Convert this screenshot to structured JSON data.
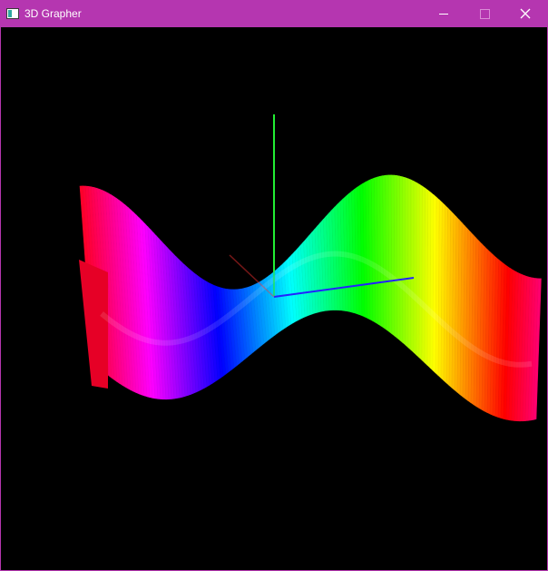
{
  "window": {
    "title": "3D Grapher",
    "icon": "app-window-icon",
    "controls": [
      "minimize-icon",
      "maximize-icon",
      "close-icon"
    ]
  },
  "colors": {
    "titlebar": "#b536b0",
    "title_text": "#ffffff",
    "background": "#000000",
    "axis_y": "#22ee33",
    "axis_z": "#2222ff",
    "axis_x": "#ff3333"
  },
  "plot": {
    "type": "3d-surface",
    "colormap": "hue-rainbow",
    "axes": [
      "x",
      "y",
      "z"
    ]
  }
}
